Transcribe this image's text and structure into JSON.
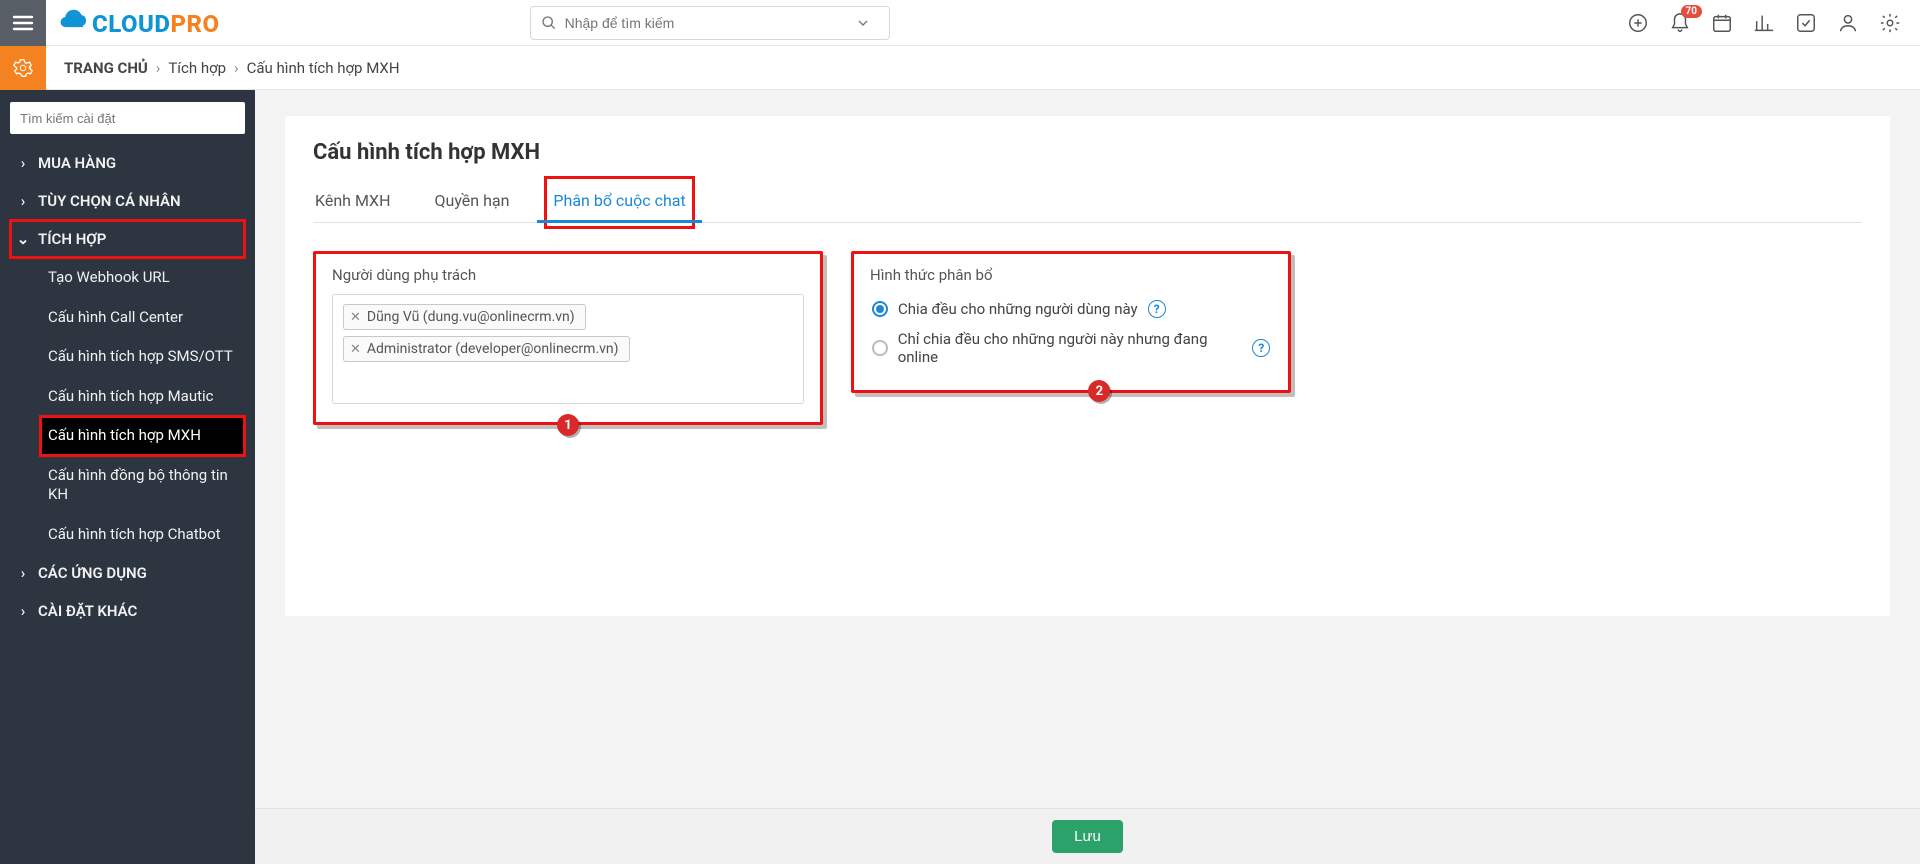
{
  "header": {
    "logo_part1": "CLOUD",
    "logo_part2": "PRO",
    "search_placeholder": "Nhập để tìm kiếm",
    "notification_count": "70"
  },
  "breadcrumb": {
    "home": "TRANG CHỦ",
    "items": [
      "Tích hợp",
      "Cấu hình tích hợp MXH"
    ]
  },
  "sidebar": {
    "filter_placeholder": "Tìm kiếm cài đặt",
    "groups": [
      {
        "label": "MUA HÀNG",
        "expanded": false
      },
      {
        "label": "TÙY CHỌN CÁ NHÂN",
        "expanded": false
      },
      {
        "label": "TÍCH HỢP",
        "expanded": true,
        "highlight": true,
        "children": [
          {
            "label": "Tạo Webhook URL"
          },
          {
            "label": "Cấu hình Call Center"
          },
          {
            "label": "Cấu hình tích hợp SMS/OTT"
          },
          {
            "label": "Cấu hình tích hợp Mautic"
          },
          {
            "label": "Cấu hình tích hợp MXH",
            "active": true
          },
          {
            "label": "Cấu hình đồng bộ thông tin KH"
          },
          {
            "label": "Cấu hình tích hợp Chatbot"
          }
        ]
      },
      {
        "label": "CÁC ỨNG DỤNG",
        "expanded": false
      },
      {
        "label": "CÀI ĐẶT KHÁC",
        "expanded": false
      }
    ]
  },
  "page": {
    "title": "Cấu hình tích hợp MXH",
    "tabs": [
      {
        "label": "Kênh MXH"
      },
      {
        "label": "Quyền hạn"
      },
      {
        "label": "Phân bổ cuộc chat",
        "active": true,
        "highlight": true
      }
    ],
    "left_panel": {
      "title": "Người dùng phụ trách",
      "badge": "1",
      "users": [
        "Dũng Vũ (dung.vu@onlinecrm.vn)",
        "Administrator (developer@onlinecrm.vn)"
      ]
    },
    "right_panel": {
      "title": "Hình thức phân bổ",
      "badge": "2",
      "options": [
        {
          "label": "Chia đều cho những người dùng này",
          "checked": true
        },
        {
          "label": "Chỉ chia đều cho những người này nhưng đang online",
          "checked": false
        }
      ]
    },
    "save_label": "Lưu"
  }
}
